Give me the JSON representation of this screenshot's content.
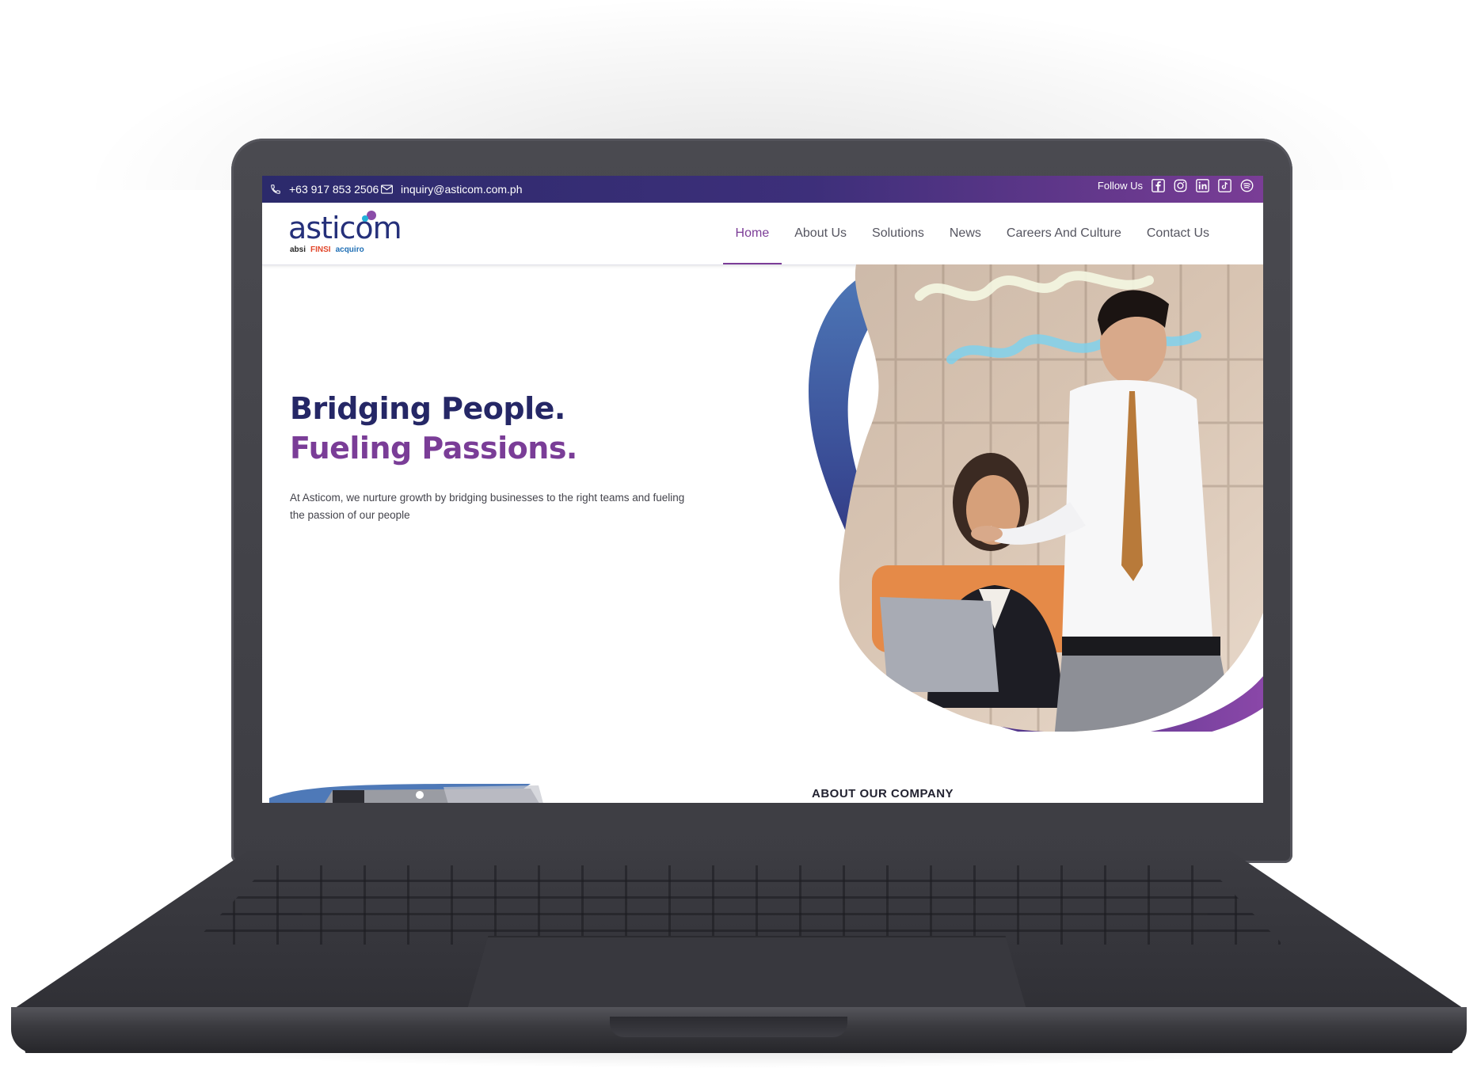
{
  "topbar": {
    "phone": "+63 917 853 2506",
    "email": "inquiry@asticom.com.ph",
    "follow_label": "Follow Us",
    "social_icons": [
      "facebook-icon",
      "instagram-icon",
      "linkedin-icon",
      "tiktok-icon",
      "spotify-icon"
    ]
  },
  "brand": {
    "name": "asticom",
    "subsidiaries": [
      "absi",
      "FINSI",
      "acquiro"
    ]
  },
  "nav": {
    "items": [
      {
        "label": "Home",
        "active": true
      },
      {
        "label": "About Us",
        "active": false
      },
      {
        "label": "Solutions",
        "active": false
      },
      {
        "label": "News",
        "active": false
      },
      {
        "label": "Careers And Culture",
        "active": false
      },
      {
        "label": "Contact Us",
        "active": false
      }
    ]
  },
  "hero": {
    "headline_line1": "Bridging People.",
    "headline_line2": "Fueling Passions.",
    "tagline": "At Asticom, we nurture growth by bridging businesses to the right teams and fueling the passion of our people"
  },
  "sections": {
    "about_label": "ABOUT OUR COMPANY"
  },
  "colors": {
    "navy": "#252766",
    "purple": "#7a3d97",
    "topbar_start": "#2b2a6b",
    "topbar_end": "#7a3d96",
    "laptop": "#3d3d43"
  }
}
